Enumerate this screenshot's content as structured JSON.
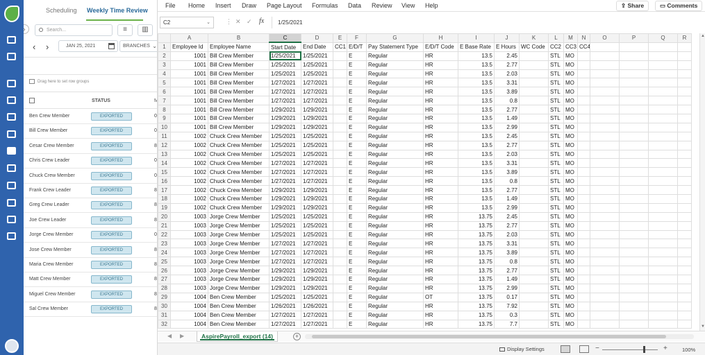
{
  "left_panel": {
    "tabs": [
      "Scheduling",
      "Weekly Time Review"
    ],
    "search_placeholder": "Search...",
    "date": "JAN 25, 2021",
    "branches": "BRANCHES",
    "drag_hint": "Drag here to set row groups",
    "col_status": "STATUS",
    "col_m": "M",
    "rows": [
      {
        "name": "Ben Crew Member",
        "status": "EXPORTED",
        "num": "0"
      },
      {
        "name": "Bill Crew Member",
        "status": "EXPORTED",
        "num": "0"
      },
      {
        "name": "Cesar Crew Member",
        "status": "EXPORTED",
        "num": "8"
      },
      {
        "name": "Chris Crew Leader",
        "status": "EXPORTED",
        "num": "0"
      },
      {
        "name": "Chuck Crew Member",
        "status": "EXPORTED",
        "num": "0"
      },
      {
        "name": "Frank Crew Leader",
        "status": "EXPORTED",
        "num": "8"
      },
      {
        "name": "Greg Crew Leader",
        "status": "EXPORTED",
        "num": "8"
      },
      {
        "name": "Joe Crew Leader",
        "status": "EXPORTED",
        "num": "8"
      },
      {
        "name": "Jorge Crew Member",
        "status": "EXPORTED",
        "num": "0"
      },
      {
        "name": "Jose Crew Member",
        "status": "EXPORTED",
        "num": "8"
      },
      {
        "name": "Maria Crew Member",
        "status": "EXPORTED",
        "num": "8"
      },
      {
        "name": "Matt Crew Member",
        "status": "EXPORTED",
        "num": "8"
      },
      {
        "name": "Miguel Crew Member",
        "status": "EXPORTED",
        "num": "8"
      },
      {
        "name": "Sal Crew Member",
        "status": "EXPORTED",
        "num": "8"
      }
    ]
  },
  "excel": {
    "menu": [
      "File",
      "Home",
      "Insert",
      "Draw",
      "Page Layout",
      "Formulas",
      "Data",
      "Review",
      "View",
      "Help"
    ],
    "share": "Share",
    "comments": "Comments",
    "name_box": "C2",
    "formula_value": "1/25/2021",
    "column_letters": [
      "A",
      "B",
      "C",
      "D",
      "E",
      "F",
      "G",
      "H",
      "I",
      "J",
      "K",
      "L",
      "M",
      "N",
      "O",
      "P",
      "Q",
      "R"
    ],
    "headers": [
      "Employee Id",
      "Employee Name",
      "Start Date",
      "End Date",
      "CC1",
      "E/D/T",
      "Pay Statement Type",
      "E/D/T Code",
      "E Base Rate",
      "E Hours",
      "WC Code",
      "CC2",
      "CC3",
      "CC4"
    ],
    "rows": [
      [
        "1001",
        "Bill Crew Member",
        "1/25/2021",
        "1/25/2021",
        "",
        "E",
        "Regular",
        "HR",
        "13.5",
        "2.45",
        "",
        "STL",
        "MO"
      ],
      [
        "1001",
        "Bill Crew Member",
        "1/25/2021",
        "1/25/2021",
        "",
        "E",
        "Regular",
        "HR",
        "13.5",
        "2.77",
        "",
        "STL",
        "MO"
      ],
      [
        "1001",
        "Bill Crew Member",
        "1/25/2021",
        "1/25/2021",
        "",
        "E",
        "Regular",
        "HR",
        "13.5",
        "2.03",
        "",
        "STL",
        "MO"
      ],
      [
        "1001",
        "Bill Crew Member",
        "1/27/2021",
        "1/27/2021",
        "",
        "E",
        "Regular",
        "HR",
        "13.5",
        "3.31",
        "",
        "STL",
        "MO"
      ],
      [
        "1001",
        "Bill Crew Member",
        "1/27/2021",
        "1/27/2021",
        "",
        "E",
        "Regular",
        "HR",
        "13.5",
        "3.89",
        "",
        "STL",
        "MO"
      ],
      [
        "1001",
        "Bill Crew Member",
        "1/27/2021",
        "1/27/2021",
        "",
        "E",
        "Regular",
        "HR",
        "13.5",
        "0.8",
        "",
        "STL",
        "MO"
      ],
      [
        "1001",
        "Bill Crew Member",
        "1/29/2021",
        "1/29/2021",
        "",
        "E",
        "Regular",
        "HR",
        "13.5",
        "2.77",
        "",
        "STL",
        "MO"
      ],
      [
        "1001",
        "Bill Crew Member",
        "1/29/2021",
        "1/29/2021",
        "",
        "E",
        "Regular",
        "HR",
        "13.5",
        "1.49",
        "",
        "STL",
        "MO"
      ],
      [
        "1001",
        "Bill Crew Member",
        "1/29/2021",
        "1/29/2021",
        "",
        "E",
        "Regular",
        "HR",
        "13.5",
        "2.99",
        "",
        "STL",
        "MO"
      ],
      [
        "1002",
        "Chuck Crew Member",
        "1/25/2021",
        "1/25/2021",
        "",
        "E",
        "Regular",
        "HR",
        "13.5",
        "2.45",
        "",
        "STL",
        "MO"
      ],
      [
        "1002",
        "Chuck Crew Member",
        "1/25/2021",
        "1/25/2021",
        "",
        "E",
        "Regular",
        "HR",
        "13.5",
        "2.77",
        "",
        "STL",
        "MO"
      ],
      [
        "1002",
        "Chuck Crew Member",
        "1/25/2021",
        "1/25/2021",
        "",
        "E",
        "Regular",
        "HR",
        "13.5",
        "2.03",
        "",
        "STL",
        "MO"
      ],
      [
        "1002",
        "Chuck Crew Member",
        "1/27/2021",
        "1/27/2021",
        "",
        "E",
        "Regular",
        "HR",
        "13.5",
        "3.31",
        "",
        "STL",
        "MO"
      ],
      [
        "1002",
        "Chuck Crew Member",
        "1/27/2021",
        "1/27/2021",
        "",
        "E",
        "Regular",
        "HR",
        "13.5",
        "3.89",
        "",
        "STL",
        "MO"
      ],
      [
        "1002",
        "Chuck Crew Member",
        "1/27/2021",
        "1/27/2021",
        "",
        "E",
        "Regular",
        "HR",
        "13.5",
        "0.8",
        "",
        "STL",
        "MO"
      ],
      [
        "1002",
        "Chuck Crew Member",
        "1/29/2021",
        "1/29/2021",
        "",
        "E",
        "Regular",
        "HR",
        "13.5",
        "2.77",
        "",
        "STL",
        "MO"
      ],
      [
        "1002",
        "Chuck Crew Member",
        "1/29/2021",
        "1/29/2021",
        "",
        "E",
        "Regular",
        "HR",
        "13.5",
        "1.49",
        "",
        "STL",
        "MO"
      ],
      [
        "1002",
        "Chuck Crew Member",
        "1/29/2021",
        "1/29/2021",
        "",
        "E",
        "Regular",
        "HR",
        "13.5",
        "2.99",
        "",
        "STL",
        "MO"
      ],
      [
        "1003",
        "Jorge Crew Member",
        "1/25/2021",
        "1/25/2021",
        "",
        "E",
        "Regular",
        "HR",
        "13.75",
        "2.45",
        "",
        "STL",
        "MO"
      ],
      [
        "1003",
        "Jorge Crew Member",
        "1/25/2021",
        "1/25/2021",
        "",
        "E",
        "Regular",
        "HR",
        "13.75",
        "2.77",
        "",
        "STL",
        "MO"
      ],
      [
        "1003",
        "Jorge Crew Member",
        "1/25/2021",
        "1/25/2021",
        "",
        "E",
        "Regular",
        "HR",
        "13.75",
        "2.03",
        "",
        "STL",
        "MO"
      ],
      [
        "1003",
        "Jorge Crew Member",
        "1/27/2021",
        "1/27/2021",
        "",
        "E",
        "Regular",
        "HR",
        "13.75",
        "3.31",
        "",
        "STL",
        "MO"
      ],
      [
        "1003",
        "Jorge Crew Member",
        "1/27/2021",
        "1/27/2021",
        "",
        "E",
        "Regular",
        "HR",
        "13.75",
        "3.89",
        "",
        "STL",
        "MO"
      ],
      [
        "1003",
        "Jorge Crew Member",
        "1/27/2021",
        "1/27/2021",
        "",
        "E",
        "Regular",
        "HR",
        "13.75",
        "0.8",
        "",
        "STL",
        "MO"
      ],
      [
        "1003",
        "Jorge Crew Member",
        "1/29/2021",
        "1/29/2021",
        "",
        "E",
        "Regular",
        "HR",
        "13.75",
        "2.77",
        "",
        "STL",
        "MO"
      ],
      [
        "1003",
        "Jorge Crew Member",
        "1/29/2021",
        "1/29/2021",
        "",
        "E",
        "Regular",
        "HR",
        "13.75",
        "1.49",
        "",
        "STL",
        "MO"
      ],
      [
        "1003",
        "Jorge Crew Member",
        "1/29/2021",
        "1/29/2021",
        "",
        "E",
        "Regular",
        "HR",
        "13.75",
        "2.99",
        "",
        "STL",
        "MO"
      ],
      [
        "1004",
        "Ben Crew Member",
        "1/25/2021",
        "1/25/2021",
        "",
        "E",
        "Regular",
        "OT",
        "13.75",
        "0.17",
        "",
        "STL",
        "MO"
      ],
      [
        "1004",
        "Ben Crew Member",
        "1/26/2021",
        "1/26/2021",
        "",
        "E",
        "Regular",
        "HR",
        "13.75",
        "7.92",
        "",
        "STL",
        "MO"
      ],
      [
        "1004",
        "Ben Crew Member",
        "1/27/2021",
        "1/27/2021",
        "",
        "E",
        "Regular",
        "HR",
        "13.75",
        "0.3",
        "",
        "STL",
        "MO"
      ],
      [
        "1004",
        "Ben Crew Member",
        "1/27/2021",
        "1/27/2021",
        "",
        "E",
        "Regular",
        "HR",
        "13.75",
        "7.7",
        "",
        "STL",
        "MO"
      ]
    ],
    "sheet_tab": "AspirePayroll_export (14)",
    "display_settings": "Display Settings",
    "zoom": "100%"
  }
}
